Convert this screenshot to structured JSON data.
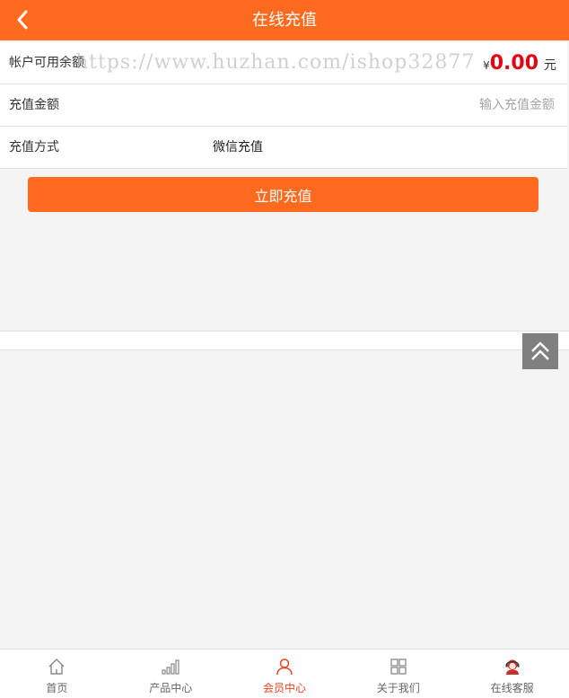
{
  "header": {
    "title": "在线充值",
    "back_icon": "chevron-left-icon"
  },
  "form": {
    "balance": {
      "label": "帐户可用余额",
      "watermark": "https://www.huzhan.com/ishop32877",
      "currency": "¥",
      "amount": "0.00",
      "unit": "元"
    },
    "amount": {
      "label": "充值金额",
      "placeholder": "输入充值金额",
      "value": ""
    },
    "method": {
      "label": "充值方式",
      "value": "微信充值"
    }
  },
  "submit_label": "立即充值",
  "back_to_top_icon": "double-chevron-up-icon",
  "tabbar": {
    "items": [
      {
        "label": "首页",
        "icon": "home-icon",
        "active": false
      },
      {
        "label": "产品中心",
        "icon": "bar-chart-icon",
        "active": false
      },
      {
        "label": "会员中心",
        "icon": "user-icon",
        "active": true
      },
      {
        "label": "关于我们",
        "icon": "grid-icon",
        "active": false
      },
      {
        "label": "在线客服",
        "icon": "customer-service-icon",
        "active": false
      }
    ]
  },
  "colors": {
    "brand": "#ff6a1f",
    "active_tab": "#e8461f",
    "amount": "#e60012"
  }
}
